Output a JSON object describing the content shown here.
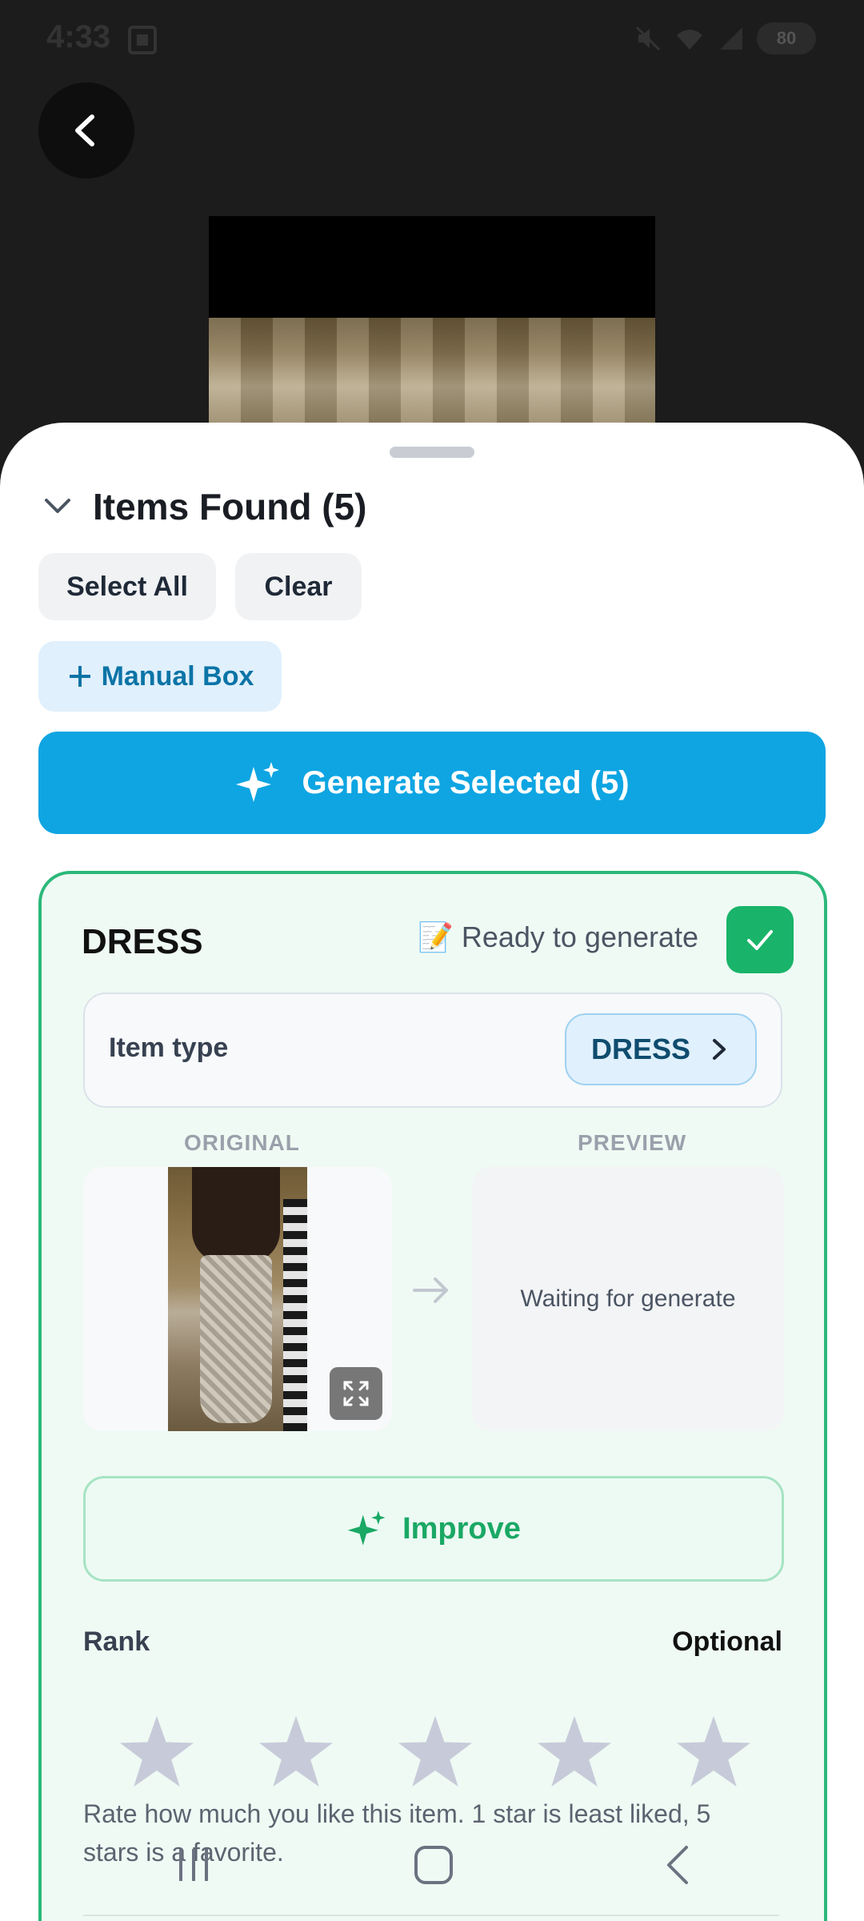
{
  "status": {
    "time": "4:33",
    "battery": "80"
  },
  "header": {
    "back_icon": "chevron-left-icon"
  },
  "items_section": {
    "title": "Items Found (5)",
    "select_all": "Select All",
    "clear": "Clear",
    "manual_box": "Manual Box",
    "generate_selected": "Generate Selected (5)"
  },
  "item_card": {
    "title": "DRESS",
    "status_emoji": "📝",
    "status_text": "Ready to generate",
    "selected": true,
    "item_type_label": "Item type",
    "item_type_value": "DRESS",
    "original_label": "ORIGINAL",
    "preview_label": "PREVIEW",
    "preview_placeholder": "Waiting for generate",
    "improve_label": "Improve",
    "rank_label": "Rank",
    "rank_optional": "Optional",
    "rating": 0,
    "rating_max": 5,
    "rank_help": "Rate how much you like this item. 1 star is least liked, 5 stars is a favorite."
  },
  "colors": {
    "accent_blue": "#0ea5e2",
    "accent_green": "#19b46a",
    "card_border": "#2bb87a",
    "star_empty": "#c7cbd9"
  }
}
